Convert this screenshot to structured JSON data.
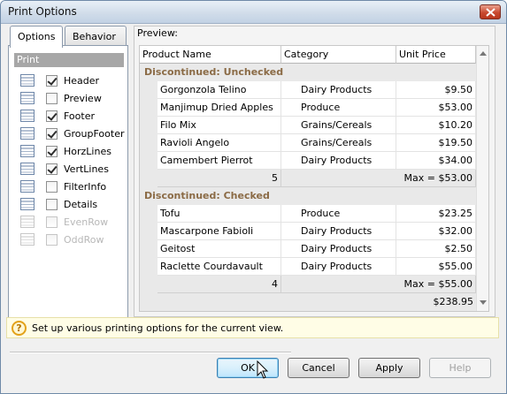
{
  "window": {
    "title": "Print Options"
  },
  "tabs": [
    {
      "label": "Options"
    },
    {
      "label": "Behavior"
    }
  ],
  "print_section": {
    "header": "Print"
  },
  "options": [
    {
      "label": "Header",
      "checked": true,
      "enabled": true,
      "icon": "header-icon"
    },
    {
      "label": "Preview",
      "checked": false,
      "enabled": true,
      "icon": "preview-icon"
    },
    {
      "label": "Footer",
      "checked": true,
      "enabled": true,
      "icon": "footer-icon"
    },
    {
      "label": "GroupFooter",
      "checked": true,
      "enabled": true,
      "icon": "group-footer-icon"
    },
    {
      "label": "HorzLines",
      "checked": true,
      "enabled": true,
      "icon": "horz-lines-icon"
    },
    {
      "label": "VertLines",
      "checked": true,
      "enabled": true,
      "icon": "vert-lines-icon"
    },
    {
      "label": "FilterInfo",
      "checked": false,
      "enabled": true,
      "icon": "filter-icon"
    },
    {
      "label": "Details",
      "checked": false,
      "enabled": true,
      "icon": "details-icon"
    },
    {
      "label": "EvenRow",
      "checked": false,
      "enabled": false,
      "icon": "even-row-icon"
    },
    {
      "label": "OddRow",
      "checked": false,
      "enabled": false,
      "icon": "odd-row-icon"
    }
  ],
  "preview": {
    "label": "Preview:",
    "columns": [
      "Product Name",
      "Category",
      "Unit Price"
    ],
    "groups": [
      {
        "title": "Discontinued: Unchecked",
        "rows": [
          {
            "name": "Gorgonzola Telino",
            "category": "Dairy Products",
            "price": "$9.50"
          },
          {
            "name": "Manjimup Dried Apples",
            "category": "Produce",
            "price": "$53.00"
          },
          {
            "name": "Filo Mix",
            "category": "Grains/Cereals",
            "price": "$10.20"
          },
          {
            "name": "Ravioli Angelo",
            "category": "Grains/Cereals",
            "price": "$19.50"
          },
          {
            "name": "Camembert Pierrot",
            "category": "Dairy Products",
            "price": "$34.00"
          }
        ],
        "footer_count": "5",
        "footer_max": "Max = $53.00"
      },
      {
        "title": "Discontinued: Checked",
        "rows": [
          {
            "name": "Tofu",
            "category": "Produce",
            "price": "$23.25"
          },
          {
            "name": "Mascarpone Fabioli",
            "category": "Dairy Products",
            "price": "$32.00"
          },
          {
            "name": "Geitost",
            "category": "Dairy Products",
            "price": "$2.50"
          },
          {
            "name": "Raclette Courdavault",
            "category": "Dairy Products",
            "price": "$55.00"
          }
        ],
        "footer_count": "4",
        "footer_max": "Max = $55.00"
      }
    ],
    "total": "$238.95"
  },
  "info": {
    "text": "Set up various printing options for the current view."
  },
  "buttons": {
    "ok": "OK",
    "cancel": "Cancel",
    "apply": "Apply",
    "help": "Help"
  }
}
